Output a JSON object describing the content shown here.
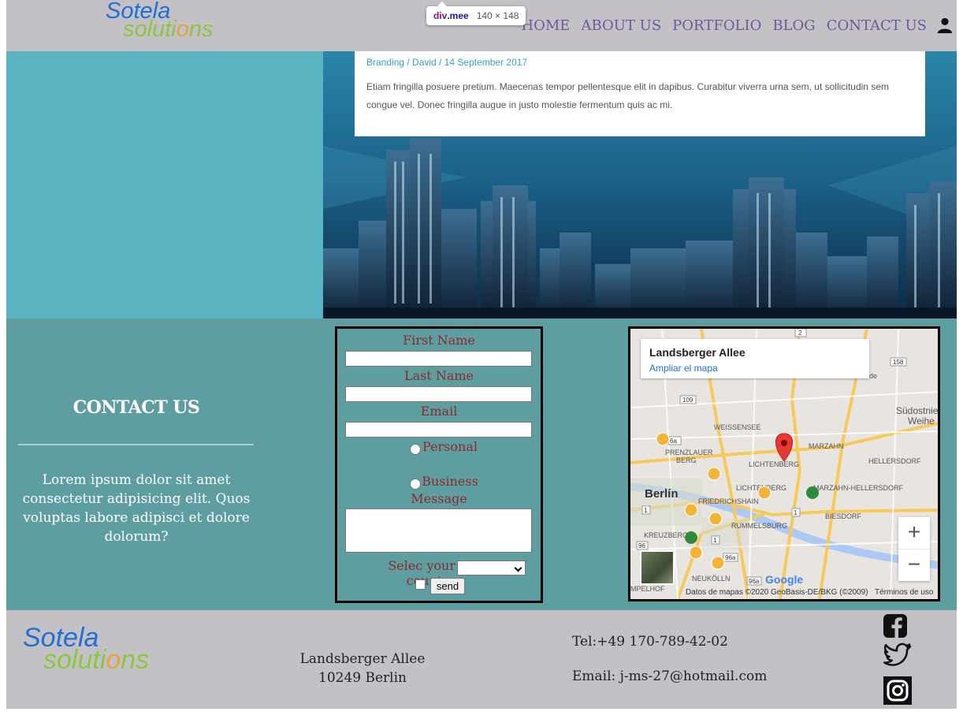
{
  "brand": {
    "line1": "Sotela",
    "line2_a": "soluti",
    "line2_o": "o",
    "line2_b": "ns"
  },
  "nav": {
    "items": [
      "HOME",
      "ABOUT US",
      "PORTFOLIO",
      "BLOG",
      "CONTACT US"
    ],
    "user_icon": "user-icon"
  },
  "devtools_tooltip": {
    "tag": "div",
    "class": ".mee",
    "size": "140 × 148"
  },
  "hero": {
    "post_meta": "Branding / David / 14 September 2017",
    "post_excerpt": "Etiam fringilla posuere pretium. Maecenas tempor pellentesque elit in dapibus. Curabitur viverra urna sem, ut sollicitudin sem congue vel. Donec fringilla augue in justo molestie fermentum quis ac mi."
  },
  "contact": {
    "title": "CONTACT US",
    "text": "Lorem ipsum dolor sit amet consectetur adipisicing elit. Quos voluptas labore adipisci et dolore dolorum?"
  },
  "form": {
    "first_name_label": "First Name",
    "last_name_label": "Last Name",
    "email_label": "Email",
    "radio_personal": "Personal",
    "radio_business": "Business",
    "message_label": "Message",
    "country_label": "Selec your country",
    "country_value": "",
    "send_label": "send"
  },
  "map": {
    "place_title": "Landsberger Allee",
    "enlarge_link": "Ampliar el mapa",
    "attribution": "Datos de mapas ©2020 GeoBasis-DE/BKG (©2009)",
    "terms": "Términos de uso",
    "zoom_in": "+",
    "zoom_out": "−",
    "google": "Google",
    "labels": {
      "weissensee": "WEISSENSEE",
      "prenzlauer": "PRENZLAUER",
      "berg": "BERG",
      "marzahn": "MARZAHN",
      "hellersdorf": "HELLERSDORF",
      "lichtenberg": "LICHTENBERG",
      "lichtenberg2": "LICHTENBERG",
      "berlin": "Berlín",
      "friedrichshain": "FRIEDRICHSHAIN",
      "mh": "MARZAHN-HELLERSDORF",
      "rummelsburg": "RUMMELSBURG",
      "biesdorf": "BIESDORF",
      "kreuzberg": "KREUZBERG",
      "neukolln": "NEUKÖLLN",
      "mpelhof": "MPELHOF",
      "sudostnie": "Südostnie",
      "weihe": "Weihe",
      "elde": "elde",
      "r2": "2",
      "r158": "158",
      "r109": "109",
      "r96a": "96a",
      "r96a2": "96a",
      "r96": "96",
      "r1": "1",
      "r1b": "1",
      "r1c": "1",
      "r6a": "6a"
    }
  },
  "footer": {
    "address_line1": "Landsberger Allee",
    "address_line2": "10249 Berlin",
    "tel": "Tel:+49 170-789-42-02",
    "email": "Email: j-ms-27@hotmail.com",
    "social_icons": [
      "facebook-icon",
      "twitter-icon",
      "instagram-icon"
    ]
  },
  "colors": {
    "nav_bg": "#c4c1c6",
    "menu_text": "#6b5a9b",
    "hero_left": "#5ab3c1",
    "contact_bg": "#5f9ea0",
    "form_label": "#8b2b2b",
    "logo_blue": "#1f6fd6",
    "logo_green": "#8cc63f"
  }
}
